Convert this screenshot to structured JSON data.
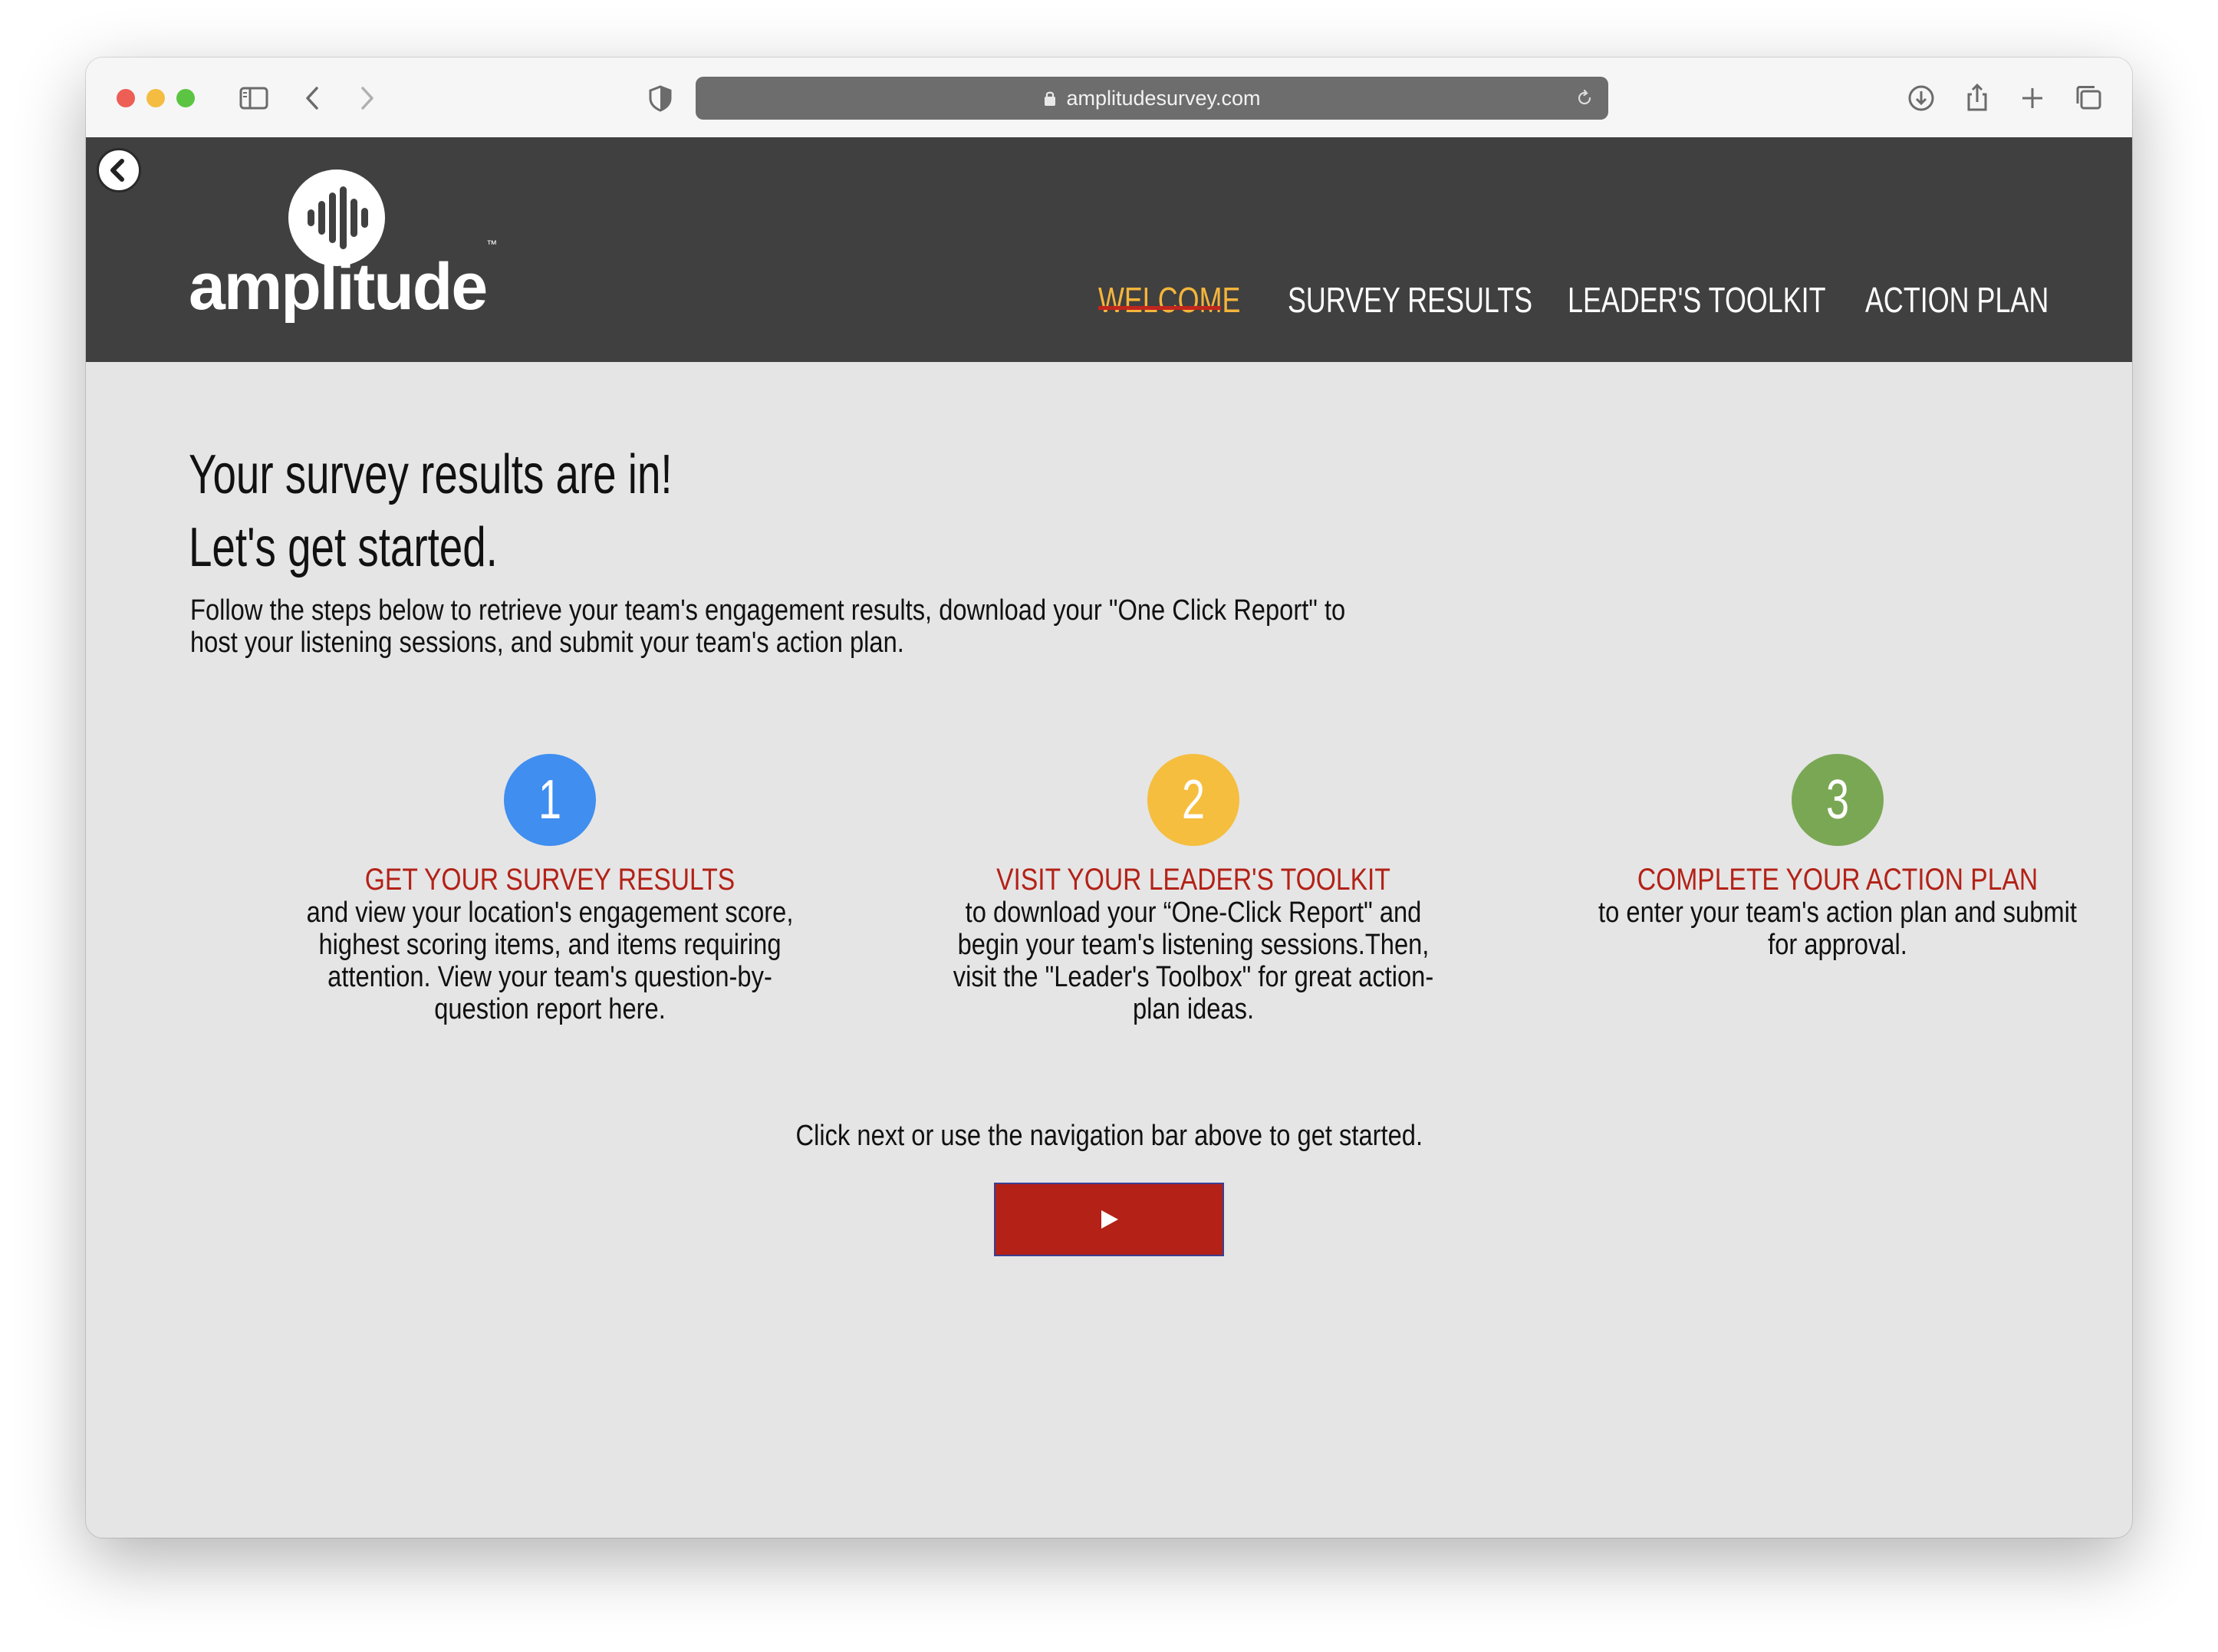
{
  "browser": {
    "url": "amplitudesurvey.com"
  },
  "site": {
    "logo_text": "amplitude",
    "trademark": "™",
    "nav": [
      {
        "label": "WELCOME",
        "active": true
      },
      {
        "label": "SURVEY RESULTS",
        "active": false
      },
      {
        "label": "LEADER'S TOOLKIT",
        "active": false
      },
      {
        "label": "ACTION PLAN",
        "active": false
      }
    ]
  },
  "main": {
    "headline_1": "Your survey results are in!",
    "headline_2": "Let's get started.",
    "intro": "Follow the steps below to retrieve your team's engagement results, download your \"One Click Report\" to host your listening sessions, and submit your team's action plan.",
    "steps": [
      {
        "number": "1",
        "color": "#3f8ef0",
        "title": "GET YOUR SURVEY RESULTS",
        "text": "and view your location's engagement score, highest scoring items, and items requiring attention. View your team's question-by-question report here."
      },
      {
        "number": "2",
        "color": "#f5be3f",
        "title": "VISIT YOUR LEADER'S TOOLKIT",
        "text": "to download your “One-Click Report\" and begin your team's listening sessions.Then, visit the \"Leader's Toolbox\" for great action-plan ideas."
      },
      {
        "number": "3",
        "color": "#7aa754",
        "title": "COMPLETE YOUR ACTION PLAN",
        "text": "to enter your team's action plan and submit for approval."
      }
    ],
    "cta_text": "Click next or use the navigation bar above to get started."
  },
  "colors": {
    "header_bg": "#404040",
    "active_nav": "#f5b53b",
    "accent_red": "#b32117",
    "page_bg": "#e5e5e5"
  },
  "icons": [
    "sidebar-icon",
    "back-arrow-icon",
    "forward-arrow-icon",
    "shield-icon",
    "lock-icon",
    "reload-icon",
    "download-icon",
    "share-icon",
    "plus-icon",
    "tabs-icon",
    "circle-back-icon",
    "waveform-logo-icon",
    "play-icon"
  ]
}
